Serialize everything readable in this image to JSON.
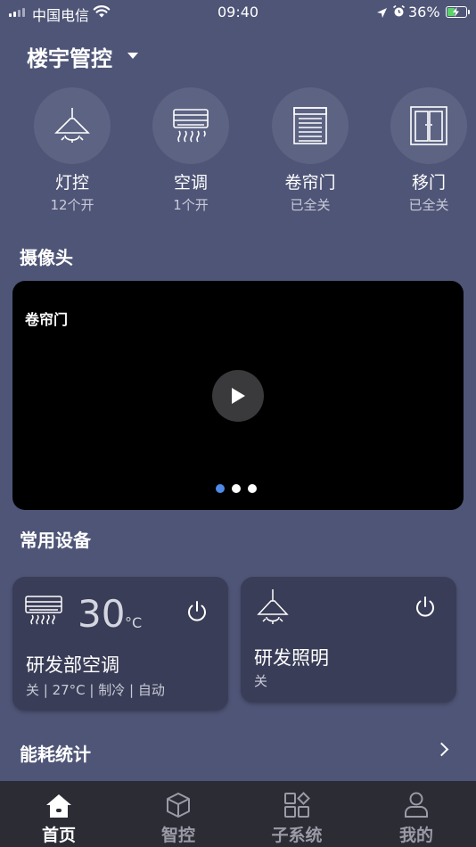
{
  "status_bar": {
    "carrier": "中国电信",
    "time": "09:40",
    "battery_percent": "36%",
    "battery_level": 0.36,
    "icons": [
      "signal-icon",
      "wifi-icon",
      "location-icon",
      "alarm-icon",
      "battery-charging-icon"
    ]
  },
  "header": {
    "title": "楼宇管控",
    "dropdown_icon": "caret-down-icon"
  },
  "categories": [
    {
      "name": "灯控",
      "status": "12个开",
      "icon": "pendant-lamp-icon"
    },
    {
      "name": "空调",
      "status": "1个开",
      "icon": "air-conditioner-icon"
    },
    {
      "name": "卷帘门",
      "status": "已全关",
      "icon": "roller-shutter-icon"
    },
    {
      "name": "移门",
      "status": "已全关",
      "icon": "sliding-door-icon"
    }
  ],
  "camera_section": {
    "title": "摄像头",
    "current_label": "卷帘门",
    "page_count": 3,
    "active_page": 1
  },
  "devices_section": {
    "title": "常用设备",
    "devices": [
      {
        "name": "研发部空调",
        "temperature": "30",
        "unit": "°C",
        "status": "关 | 27°C | 制冷 | 自动",
        "icon": "air-conditioner-icon"
      },
      {
        "name": "研发照明",
        "status": "关",
        "icon": "pendant-lamp-icon"
      }
    ]
  },
  "energy_section": {
    "title": "能耗统计"
  },
  "tabbar": [
    {
      "label": "首页",
      "icon": "home-icon",
      "active": true
    },
    {
      "label": "智控",
      "icon": "cube-icon",
      "active": false
    },
    {
      "label": "子系统",
      "icon": "apps-grid-icon",
      "active": false
    },
    {
      "label": "我的",
      "icon": "user-icon",
      "active": false
    }
  ],
  "colors": {
    "background": "#4f5577",
    "card": "#393d57",
    "accent": "#4f8ae8",
    "tabbar": "#2b2c34"
  }
}
